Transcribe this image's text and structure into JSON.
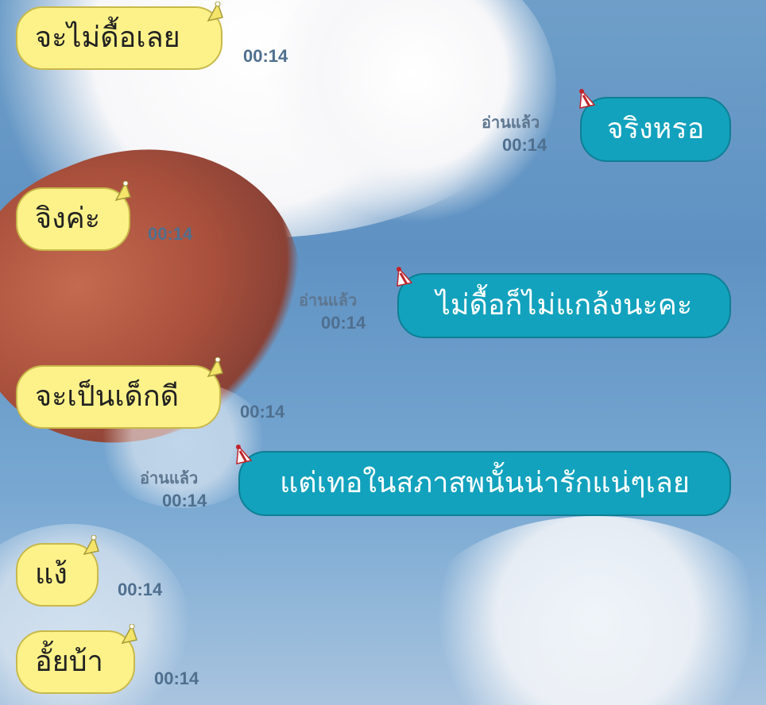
{
  "chat": {
    "read_label": "อ่านแล้ว",
    "messages": [
      {
        "side": "incoming",
        "text": "จะไม่ดื้อเลย",
        "time": "00:14"
      },
      {
        "side": "outgoing",
        "text": "จริงหรอ",
        "time": "00:14",
        "status": "อ่านแล้ว"
      },
      {
        "side": "incoming",
        "text": "จิงค่ะ",
        "time": "00:14"
      },
      {
        "side": "outgoing",
        "text": "ไม่ดื้อก็ไม่แกล้งนะคะ",
        "time": "00:14",
        "status": "อ่านแล้ว"
      },
      {
        "side": "incoming",
        "text": "จะเป็นเด็กดี",
        "time": "00:14"
      },
      {
        "side": "outgoing",
        "text": "แต่เทอในสภาสพนั้นน่ารักแน่ๆเลย",
        "time": "00:14",
        "status": "อ่านแล้ว"
      },
      {
        "side": "incoming",
        "text": "แง้",
        "time": "00:14"
      },
      {
        "side": "incoming",
        "text": "อั้ยบ้า",
        "time": "00:14"
      }
    ]
  },
  "colors": {
    "incoming_bubble": "#fdf28a",
    "outgoing_bubble": "#12a2bd",
    "timestamp": "#4f6f8f"
  },
  "icons": {
    "incoming_hat": "party-hat-icon",
    "outgoing_hat": "party-hat-icon"
  }
}
